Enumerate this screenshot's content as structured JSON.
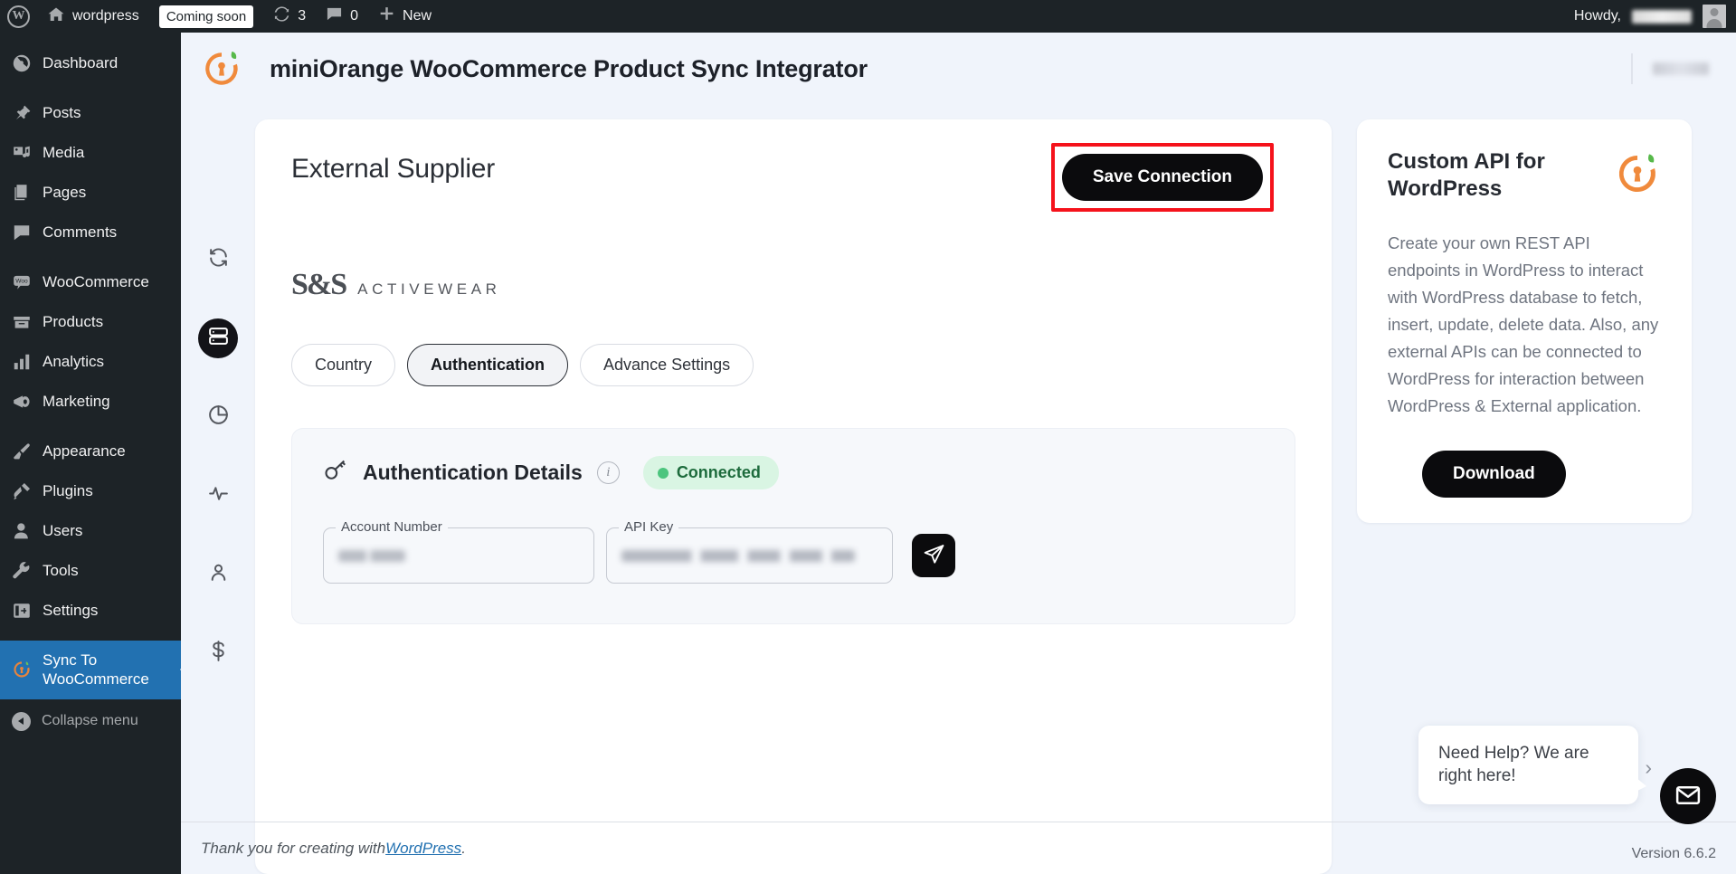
{
  "adminbar": {
    "wp_logo_icon": "wordpress-logo-icon",
    "site_icon": "home-icon",
    "site_name": "wordpress",
    "coming_soon_label": "Coming soon",
    "updates_icon": "updates-sync-icon",
    "updates_count": "3",
    "comments_icon": "comment-bubble-icon",
    "comments_count": "0",
    "new_icon": "plus-icon",
    "new_label": "New",
    "howdy_label": "Howdy,",
    "user_name_redacted": "",
    "avatar_icon": "avatar-icon"
  },
  "sidebar": {
    "items": [
      {
        "label": "Dashboard",
        "icon": "dashboard-icon",
        "active": false
      },
      {
        "label": "Posts",
        "icon": "pin-icon",
        "active": false
      },
      {
        "label": "Media",
        "icon": "media-icon",
        "active": false
      },
      {
        "label": "Pages",
        "icon": "pages-icon",
        "active": false
      },
      {
        "label": "Comments",
        "icon": "comment-bubble-icon",
        "active": false
      },
      {
        "label": "WooCommerce",
        "icon": "woo-icon",
        "active": false
      },
      {
        "label": "Products",
        "icon": "products-icon",
        "active": false
      },
      {
        "label": "Analytics",
        "icon": "bar-chart-icon",
        "active": false
      },
      {
        "label": "Marketing",
        "icon": "megaphone-icon",
        "active": false
      },
      {
        "label": "Appearance",
        "icon": "paintbrush-icon",
        "active": false
      },
      {
        "label": "Plugins",
        "icon": "plug-icon",
        "active": false
      },
      {
        "label": "Users",
        "icon": "user-icon",
        "active": false
      },
      {
        "label": "Tools",
        "icon": "wrench-icon",
        "active": false
      },
      {
        "label": "Settings",
        "icon": "settings-sliders-icon",
        "active": false
      },
      {
        "label": "Sync To WooCommerce",
        "icon": "miniorange-icon",
        "active": true
      }
    ],
    "collapse_label": "Collapse menu",
    "collapse_icon": "collapse-arrow-icon",
    "active_color": "#2271b1",
    "background_color": "#1d2327"
  },
  "header": {
    "logo_icon": "miniorange-logo-icon",
    "title": "miniOrange WooCommerce Product Sync Integrator",
    "right_redacted": ""
  },
  "icon_rail": {
    "items": [
      {
        "icon": "sync-refresh-icon",
        "active": false
      },
      {
        "icon": "server-database-icon",
        "active": true
      },
      {
        "icon": "pie-chart-icon",
        "active": false
      },
      {
        "icon": "activity-pulse-icon",
        "active": false
      },
      {
        "icon": "user-profile-icon",
        "active": false
      },
      {
        "icon": "dollar-sign-icon",
        "active": false
      }
    ]
  },
  "main": {
    "section_title": "External Supplier",
    "save_button_label": "Save Connection",
    "save_button_highlight_color": "#f5121b",
    "supplier_logo": {
      "mark": "S&S",
      "word": "ACTIVEWEAR"
    },
    "tabs": [
      {
        "label": "Country",
        "active": false
      },
      {
        "label": "Authentication",
        "active": true
      },
      {
        "label": "Advance Settings",
        "active": false
      }
    ],
    "auth": {
      "key_icon": "key-icon",
      "heading": "Authentication Details",
      "info_icon": "info-icon",
      "status_label": "Connected",
      "status_color": "#4cc57e",
      "status_bg_color": "#d9f5e3",
      "fields": [
        {
          "label": "Account Number",
          "value": "",
          "placeholder": "Account Number"
        },
        {
          "label": "API Key",
          "value": "",
          "placeholder": "API Key"
        }
      ],
      "send_button_icon": "send-paper-plane-icon"
    }
  },
  "promo": {
    "title": "Custom API for WordPress",
    "logo_icon": "miniorange-logo-icon",
    "body": "Create your own REST API endpoints in WordPress to interact with WordPress database to fetch, insert, update, delete data. Also, any external APIs can be connected to WordPress for interaction between WordPress & External application.",
    "download_label": "Download"
  },
  "footer": {
    "thanks_prefix": "Thank you for creating with ",
    "wordpress_link": "WordPress",
    "thanks_suffix": ".",
    "version_label": "Version 6.6.2"
  },
  "chat": {
    "bubble_text": "Need Help? We are right here!",
    "collapse_icon": "chevron-right-icon",
    "fab_icon": "envelope-icon"
  }
}
